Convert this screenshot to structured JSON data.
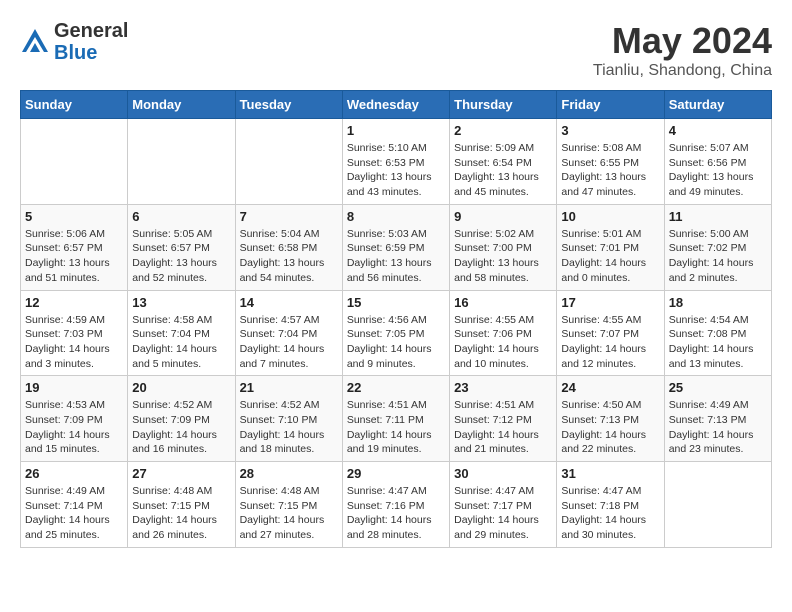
{
  "header": {
    "logo_line1": "General",
    "logo_line2": "Blue",
    "month": "May 2024",
    "location": "Tianliu, Shandong, China"
  },
  "days_of_week": [
    "Sunday",
    "Monday",
    "Tuesday",
    "Wednesday",
    "Thursday",
    "Friday",
    "Saturday"
  ],
  "weeks": [
    [
      {
        "day": "",
        "info": ""
      },
      {
        "day": "",
        "info": ""
      },
      {
        "day": "",
        "info": ""
      },
      {
        "day": "1",
        "info": "Sunrise: 5:10 AM\nSunset: 6:53 PM\nDaylight: 13 hours\nand 43 minutes."
      },
      {
        "day": "2",
        "info": "Sunrise: 5:09 AM\nSunset: 6:54 PM\nDaylight: 13 hours\nand 45 minutes."
      },
      {
        "day": "3",
        "info": "Sunrise: 5:08 AM\nSunset: 6:55 PM\nDaylight: 13 hours\nand 47 minutes."
      },
      {
        "day": "4",
        "info": "Sunrise: 5:07 AM\nSunset: 6:56 PM\nDaylight: 13 hours\nand 49 minutes."
      }
    ],
    [
      {
        "day": "5",
        "info": "Sunrise: 5:06 AM\nSunset: 6:57 PM\nDaylight: 13 hours\nand 51 minutes."
      },
      {
        "day": "6",
        "info": "Sunrise: 5:05 AM\nSunset: 6:57 PM\nDaylight: 13 hours\nand 52 minutes."
      },
      {
        "day": "7",
        "info": "Sunrise: 5:04 AM\nSunset: 6:58 PM\nDaylight: 13 hours\nand 54 minutes."
      },
      {
        "day": "8",
        "info": "Sunrise: 5:03 AM\nSunset: 6:59 PM\nDaylight: 13 hours\nand 56 minutes."
      },
      {
        "day": "9",
        "info": "Sunrise: 5:02 AM\nSunset: 7:00 PM\nDaylight: 13 hours\nand 58 minutes."
      },
      {
        "day": "10",
        "info": "Sunrise: 5:01 AM\nSunset: 7:01 PM\nDaylight: 14 hours\nand 0 minutes."
      },
      {
        "day": "11",
        "info": "Sunrise: 5:00 AM\nSunset: 7:02 PM\nDaylight: 14 hours\nand 2 minutes."
      }
    ],
    [
      {
        "day": "12",
        "info": "Sunrise: 4:59 AM\nSunset: 7:03 PM\nDaylight: 14 hours\nand 3 minutes."
      },
      {
        "day": "13",
        "info": "Sunrise: 4:58 AM\nSunset: 7:04 PM\nDaylight: 14 hours\nand 5 minutes."
      },
      {
        "day": "14",
        "info": "Sunrise: 4:57 AM\nSunset: 7:04 PM\nDaylight: 14 hours\nand 7 minutes."
      },
      {
        "day": "15",
        "info": "Sunrise: 4:56 AM\nSunset: 7:05 PM\nDaylight: 14 hours\nand 9 minutes."
      },
      {
        "day": "16",
        "info": "Sunrise: 4:55 AM\nSunset: 7:06 PM\nDaylight: 14 hours\nand 10 minutes."
      },
      {
        "day": "17",
        "info": "Sunrise: 4:55 AM\nSunset: 7:07 PM\nDaylight: 14 hours\nand 12 minutes."
      },
      {
        "day": "18",
        "info": "Sunrise: 4:54 AM\nSunset: 7:08 PM\nDaylight: 14 hours\nand 13 minutes."
      }
    ],
    [
      {
        "day": "19",
        "info": "Sunrise: 4:53 AM\nSunset: 7:09 PM\nDaylight: 14 hours\nand 15 minutes."
      },
      {
        "day": "20",
        "info": "Sunrise: 4:52 AM\nSunset: 7:09 PM\nDaylight: 14 hours\nand 16 minutes."
      },
      {
        "day": "21",
        "info": "Sunrise: 4:52 AM\nSunset: 7:10 PM\nDaylight: 14 hours\nand 18 minutes."
      },
      {
        "day": "22",
        "info": "Sunrise: 4:51 AM\nSunset: 7:11 PM\nDaylight: 14 hours\nand 19 minutes."
      },
      {
        "day": "23",
        "info": "Sunrise: 4:51 AM\nSunset: 7:12 PM\nDaylight: 14 hours\nand 21 minutes."
      },
      {
        "day": "24",
        "info": "Sunrise: 4:50 AM\nSunset: 7:13 PM\nDaylight: 14 hours\nand 22 minutes."
      },
      {
        "day": "25",
        "info": "Sunrise: 4:49 AM\nSunset: 7:13 PM\nDaylight: 14 hours\nand 23 minutes."
      }
    ],
    [
      {
        "day": "26",
        "info": "Sunrise: 4:49 AM\nSunset: 7:14 PM\nDaylight: 14 hours\nand 25 minutes."
      },
      {
        "day": "27",
        "info": "Sunrise: 4:48 AM\nSunset: 7:15 PM\nDaylight: 14 hours\nand 26 minutes."
      },
      {
        "day": "28",
        "info": "Sunrise: 4:48 AM\nSunset: 7:15 PM\nDaylight: 14 hours\nand 27 minutes."
      },
      {
        "day": "29",
        "info": "Sunrise: 4:47 AM\nSunset: 7:16 PM\nDaylight: 14 hours\nand 28 minutes."
      },
      {
        "day": "30",
        "info": "Sunrise: 4:47 AM\nSunset: 7:17 PM\nDaylight: 14 hours\nand 29 minutes."
      },
      {
        "day": "31",
        "info": "Sunrise: 4:47 AM\nSunset: 7:18 PM\nDaylight: 14 hours\nand 30 minutes."
      },
      {
        "day": "",
        "info": ""
      }
    ]
  ]
}
